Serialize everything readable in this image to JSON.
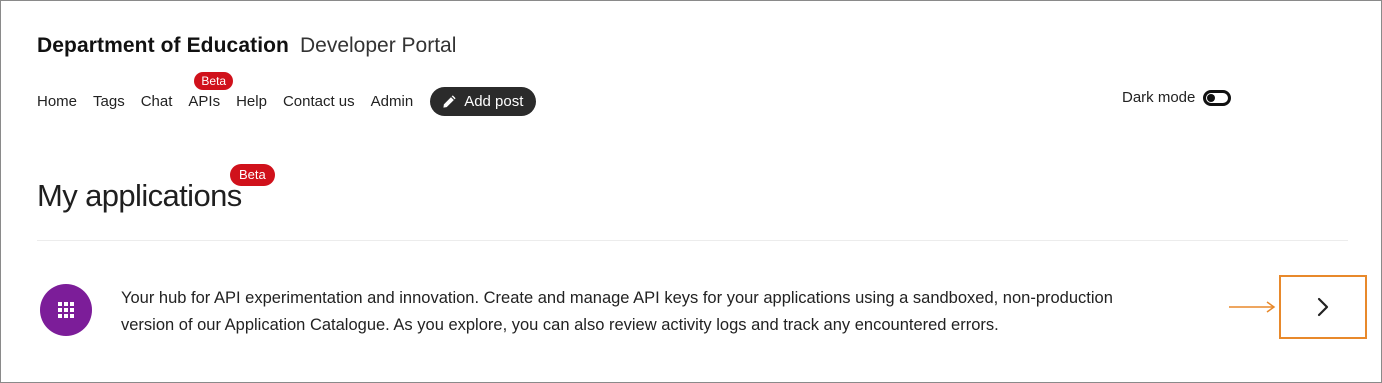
{
  "header": {
    "org_title": "Department of Education",
    "portal_title": "Developer Portal"
  },
  "nav": {
    "items": [
      {
        "label": "Home"
      },
      {
        "label": "Tags"
      },
      {
        "label": "Chat"
      },
      {
        "label": "APIs",
        "badge": "Beta"
      },
      {
        "label": "Help"
      },
      {
        "label": "Contact us"
      },
      {
        "label": "Admin"
      }
    ],
    "add_post": {
      "label": "Add post",
      "icon": "pencil-icon"
    }
  },
  "dark_mode": {
    "label": "Dark mode",
    "enabled": false
  },
  "page": {
    "title": "My applications",
    "title_badge": "Beta",
    "card": {
      "icon": "app-grid-icon",
      "icon_color": "#7c1d99",
      "description": "Your hub for API experimentation and innovation. Create and manage API keys for your applications using a sandboxed, non-production version of our Application Catalogue. As you explore, you can also review activity logs and track any encountered errors.",
      "action_icon": "chevron-right-icon"
    }
  },
  "colors": {
    "badge": "#d0111b",
    "add_post_bg": "#2b2b2b",
    "highlight": "#e8892b"
  }
}
